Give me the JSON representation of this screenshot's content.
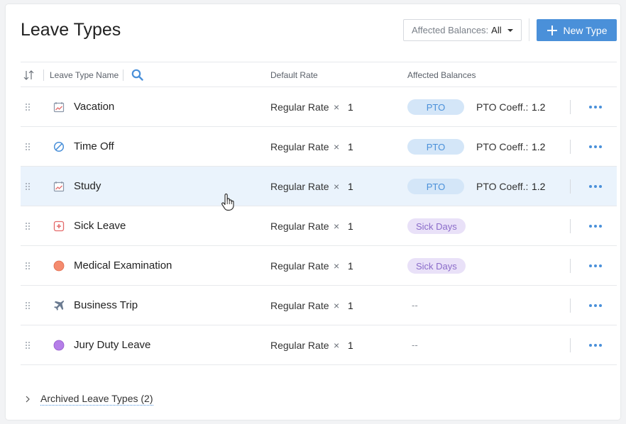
{
  "page": {
    "title": "Leave Types",
    "filter": {
      "label": "Affected Balances:",
      "value": "All"
    },
    "new_button": "New Type"
  },
  "table": {
    "columns": {
      "name": "Leave Type Name",
      "rate": "Default Rate",
      "affected": "Affected Balances"
    },
    "rows": [
      {
        "name": "Vacation",
        "icon": "calendar-chart-icon",
        "rate": "Regular Rate",
        "times": "×",
        "multiplier": "1",
        "balance": "PTO",
        "balance_type": "pto",
        "coeff_label": "PTO Coeff.:",
        "coeff_value": "1.2"
      },
      {
        "name": "Time Off",
        "icon": "prohibited-icon",
        "rate": "Regular Rate",
        "times": "×",
        "multiplier": "1",
        "balance": "PTO",
        "balance_type": "pto",
        "coeff_label": "PTO Coeff.:",
        "coeff_value": "1.2"
      },
      {
        "name": "Study",
        "icon": "calendar-chart-icon",
        "rate": "Regular Rate",
        "times": "×",
        "multiplier": "1",
        "balance": "PTO",
        "balance_type": "pto",
        "coeff_label": "PTO Coeff.:",
        "coeff_value": "1.2"
      },
      {
        "name": "Sick Leave",
        "icon": "medical-cross-icon",
        "rate": "Regular Rate",
        "times": "×",
        "multiplier": "1",
        "balance": "Sick Days",
        "balance_type": "sick",
        "coeff_label": "",
        "coeff_value": ""
      },
      {
        "name": "Medical Examination",
        "icon": "orange-dot-icon",
        "rate": "Regular Rate",
        "times": "×",
        "multiplier": "1",
        "balance": "Sick Days",
        "balance_type": "sick",
        "coeff_label": "",
        "coeff_value": ""
      },
      {
        "name": "Business Trip",
        "icon": "airplane-icon",
        "rate": "Regular Rate",
        "times": "×",
        "multiplier": "1",
        "balance": "--",
        "balance_type": "none",
        "coeff_label": "",
        "coeff_value": ""
      },
      {
        "name": "Jury Duty Leave",
        "icon": "purple-dot-icon",
        "rate": "Regular Rate",
        "times": "×",
        "multiplier": "1",
        "balance": "--",
        "balance_type": "none",
        "coeff_label": "",
        "coeff_value": ""
      }
    ]
  },
  "archived": {
    "label": "Archived Leave Types (2)"
  },
  "colors": {
    "accent": "#4a90d9",
    "pto_bg": "#d4e6f8",
    "sick_bg": "#e9e1f8",
    "sick_text": "#8a6bc9",
    "hover_row": "#eaf3fc",
    "orange_dot": "#f48b6e",
    "purple_dot": "#b57ee8"
  }
}
